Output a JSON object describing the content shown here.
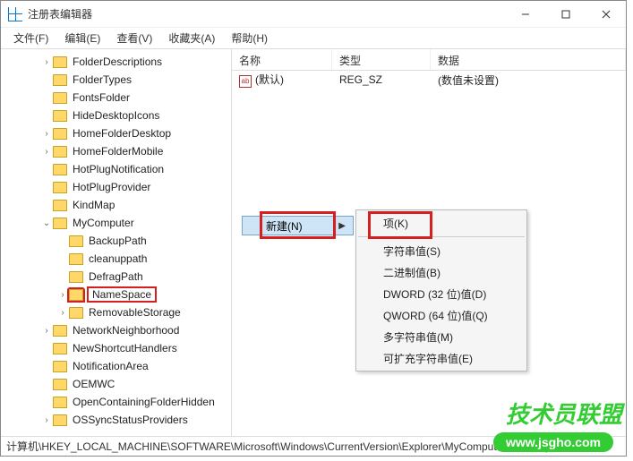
{
  "title": "注册表编辑器",
  "menu": {
    "file": "文件(F)",
    "edit": "编辑(E)",
    "view": "查看(V)",
    "fav": "收藏夹(A)",
    "help": "帮助(H)"
  },
  "tree": {
    "items": [
      {
        "depth": 2,
        "chev": "›",
        "label": "FolderDescriptions"
      },
      {
        "depth": 2,
        "chev": "",
        "label": "FolderTypes"
      },
      {
        "depth": 2,
        "chev": "",
        "label": "FontsFolder"
      },
      {
        "depth": 2,
        "chev": "",
        "label": "HideDesktopIcons"
      },
      {
        "depth": 2,
        "chev": "›",
        "label": "HomeFolderDesktop"
      },
      {
        "depth": 2,
        "chev": "›",
        "label": "HomeFolderMobile"
      },
      {
        "depth": 2,
        "chev": "",
        "label": "HotPlugNotification"
      },
      {
        "depth": 2,
        "chev": "",
        "label": "HotPlugProvider"
      },
      {
        "depth": 2,
        "chev": "",
        "label": "KindMap"
      },
      {
        "depth": 2,
        "chev": "⌄",
        "label": "MyComputer"
      },
      {
        "depth": 3,
        "chev": "",
        "label": "BackupPath"
      },
      {
        "depth": 3,
        "chev": "",
        "label": "cleanuppath"
      },
      {
        "depth": 3,
        "chev": "",
        "label": "DefragPath"
      },
      {
        "depth": 3,
        "chev": "›",
        "label": "NameSpace",
        "hl": true
      },
      {
        "depth": 3,
        "chev": "›",
        "label": "RemovableStorage"
      },
      {
        "depth": 2,
        "chev": "›",
        "label": "NetworkNeighborhood"
      },
      {
        "depth": 2,
        "chev": "",
        "label": "NewShortcutHandlers"
      },
      {
        "depth": 2,
        "chev": "",
        "label": "NotificationArea"
      },
      {
        "depth": 2,
        "chev": "",
        "label": "OEMWC"
      },
      {
        "depth": 2,
        "chev": "",
        "label": "OpenContainingFolderHidden"
      },
      {
        "depth": 2,
        "chev": "›",
        "label": "OSSyncStatusProviders"
      }
    ]
  },
  "columns": {
    "name": "名称",
    "type": "类型",
    "data": "数据"
  },
  "row": {
    "icon": "ab",
    "name": "(默认)",
    "type": "REG_SZ",
    "data": "(数值未设置)"
  },
  "ctx": {
    "new": "新建(N)"
  },
  "submenu": {
    "key": "项(K)",
    "string": "字符串值(S)",
    "binary": "二进制值(B)",
    "dword": "DWORD (32 位)值(D)",
    "qword": "QWORD (64 位)值(Q)",
    "multi": "多字符串值(M)",
    "expand": "可扩充字符串值(E)"
  },
  "status": "计算机\\HKEY_LOCAL_MACHINE\\SOFTWARE\\Microsoft\\Windows\\CurrentVersion\\Explorer\\MyComputer\\NameSpace",
  "watermark": {
    "text": "技术员联盟",
    "url": "www.jsgho.com"
  }
}
